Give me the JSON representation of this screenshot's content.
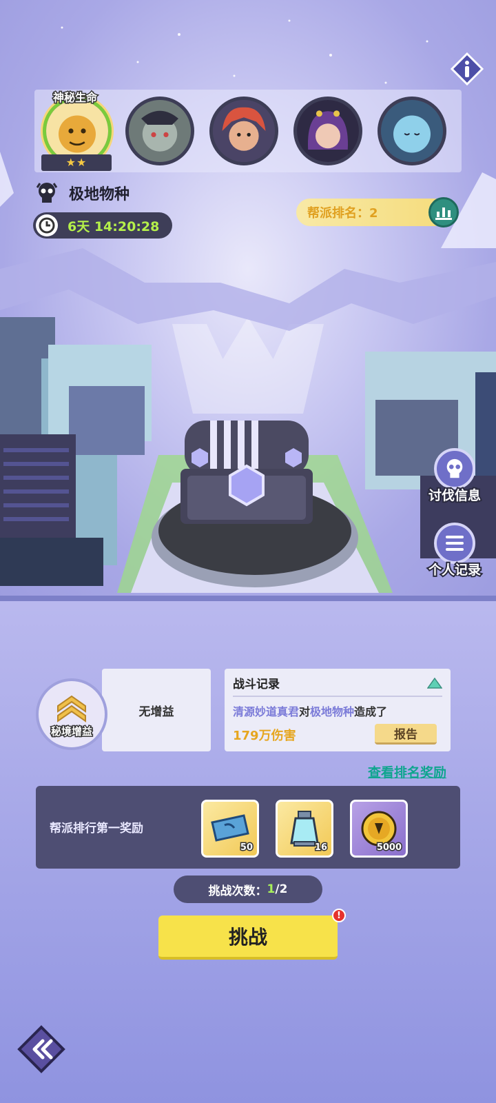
{
  "header": {
    "active_boss_label": "神秘生命",
    "stars": "★★",
    "boss_name": "极地物种",
    "timer": "6天 14:20:28",
    "rank_label": "帮派排名：2"
  },
  "portraits": [
    {
      "name": "golden-beast",
      "color": "#f2c45a"
    },
    {
      "name": "grey-warrior",
      "color": "#8f9a9a"
    },
    {
      "name": "red-hair-hero",
      "color": "#c64b3d"
    },
    {
      "name": "purple-hair-girl",
      "color": "#7a4ba0"
    },
    {
      "name": "blue-sleeper",
      "color": "#5da3c6"
    }
  ],
  "side_buttons": {
    "crusade_info": "讨伐信息",
    "personal_record": "个人记录"
  },
  "buff": {
    "circle_label": "秘境增益",
    "status": "无增益"
  },
  "battle_log": {
    "title": "战斗记录",
    "player": "清源妙道真君",
    "verb": "对",
    "target": "极地物种",
    "suffix": "造成了",
    "damage": "179万伤害",
    "report_button": "报告"
  },
  "rank_reward_link": "查看排名奖励",
  "reward_panel": {
    "title": "帮派排行第一奖励",
    "items": [
      {
        "icon": "ticket-icon",
        "qty": "50"
      },
      {
        "icon": "crystal-vial-icon",
        "qty": "16"
      },
      {
        "icon": "gold-coin-icon",
        "qty": "5000"
      }
    ]
  },
  "attempts": {
    "label": "挑战次数：",
    "current": "1",
    "total": "/2"
  },
  "challenge_button": "挑战",
  "alert_mark": "!"
}
